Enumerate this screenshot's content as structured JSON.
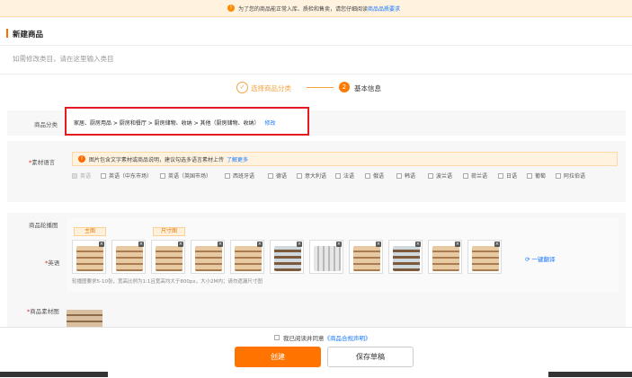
{
  "notice": {
    "icon": "warning-icon",
    "text": "为了您的商品能正常入库、质检和售卖，请您仔细阅读",
    "link": "商品品质要求"
  },
  "header": {
    "title": "新建商品",
    "category_search_placeholder": "如需修改类目，请在这里输入类目"
  },
  "steps": [
    {
      "number": "✓",
      "label": "选择商品分类",
      "state": "done"
    },
    {
      "number": "2",
      "label": "基本信息",
      "state": "active"
    }
  ],
  "category": {
    "label": "商品分类",
    "path": "家居、厨房用品 > 厨房和餐厅 > 厨房储物、收纳 > 其他（厨房储物、收纳）",
    "edit": "修改"
  },
  "material_language": {
    "label": "素材语言",
    "tip": "图片包含文字素材或商品说明，建议勾选多语言素材上传",
    "tip_link": "了解更多",
    "options": [
      {
        "label": "英语",
        "checked": true
      },
      {
        "label": "英语（中东市场）",
        "checked": false
      },
      {
        "label": "英语（英国市场）",
        "checked": false
      },
      {
        "label": "西班牙语",
        "checked": false
      },
      {
        "label": "德语",
        "checked": false
      },
      {
        "label": "意大利语",
        "checked": false
      },
      {
        "label": "法语",
        "checked": false
      },
      {
        "label": "俄语",
        "checked": false
      },
      {
        "label": "韩语",
        "checked": false
      },
      {
        "label": "波兰语",
        "checked": false
      },
      {
        "label": "荷兰语",
        "checked": false
      },
      {
        "label": "日语",
        "checked": false
      },
      {
        "label": "葡萄",
        "checked": false
      },
      {
        "label": "阿拉伯语",
        "checked": false
      }
    ]
  },
  "images": {
    "label": "商品轮播图",
    "language": "英语",
    "tags": {
      "main": "主图",
      "size": "尺寸图"
    },
    "one_click": "一键翻译",
    "hint": "轮播图要求5-10张，宽高比例为1:1且宽高均大于800px，大小2M内；请勿遗漏尺寸图",
    "white_label": "商品素材图"
  },
  "footer": {
    "agree_text": "我已阅读并同意",
    "agree_link": "《商品合规声明》",
    "create": "创建",
    "save_draft": "保存草稿"
  },
  "colors": {
    "accent": "#ff7300",
    "link": "#1677ff",
    "highlight_border": "#e31b23"
  }
}
